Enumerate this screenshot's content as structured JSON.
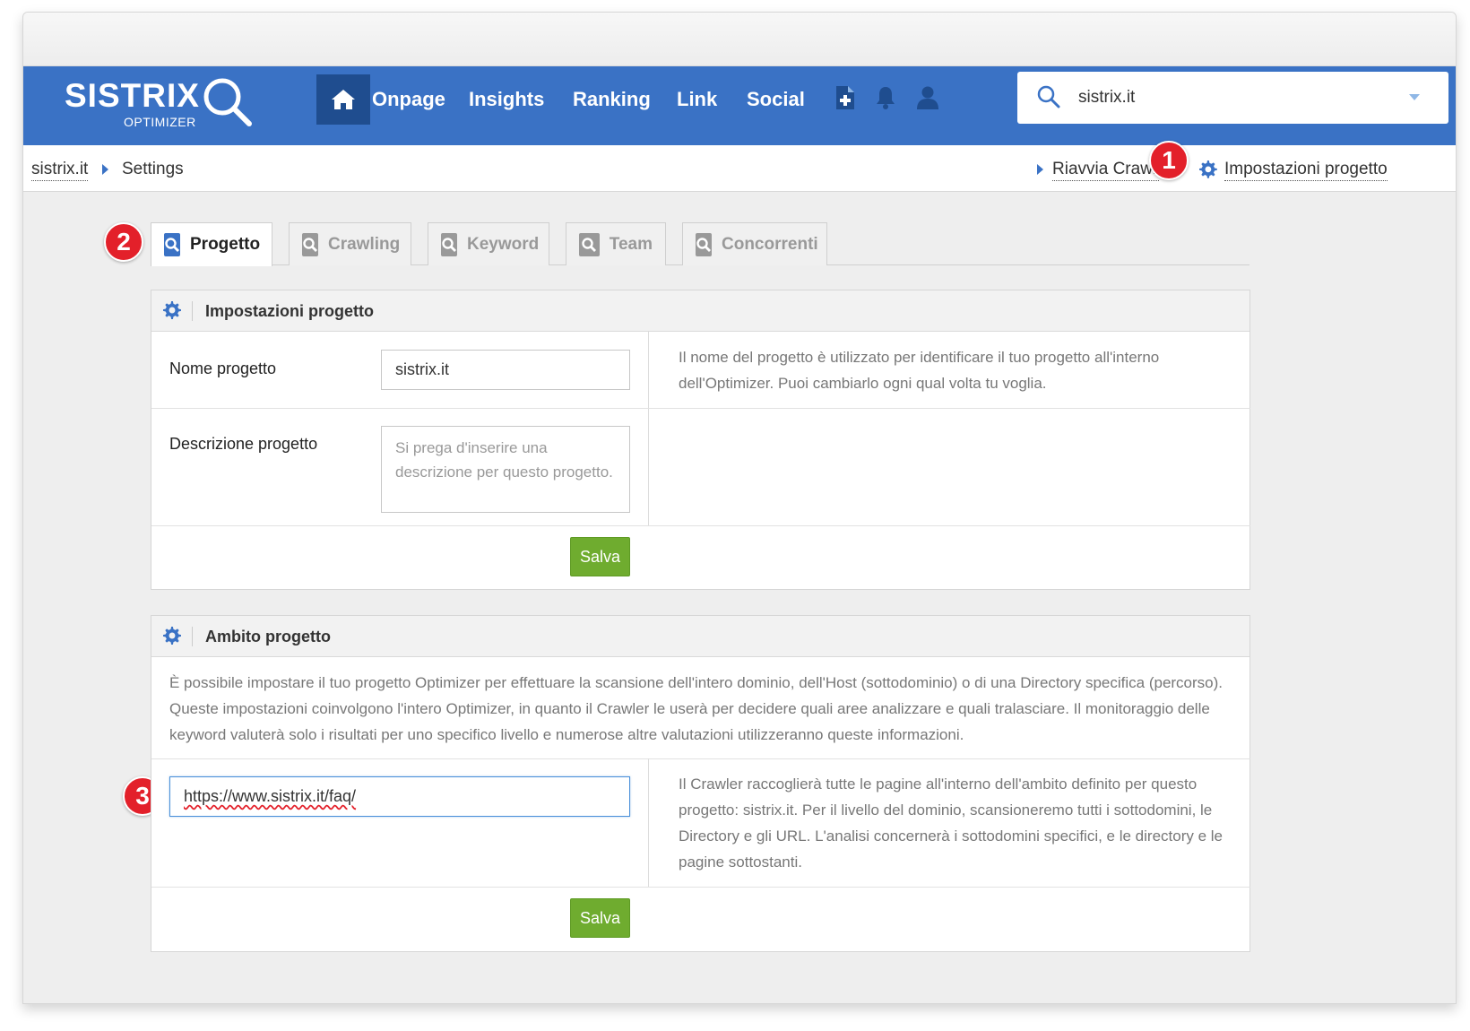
{
  "navbar": {
    "logo_text": "SISTRIX",
    "logo_sub": "OPTIMIZER",
    "items": [
      "Onpage",
      "Insights",
      "Ranking",
      "Link",
      "Social"
    ],
    "search_value": "sistrix.it"
  },
  "breadcrumb": {
    "project": "sistrix.it",
    "current": "Settings",
    "restart_crawler": "Riavvia Crawler",
    "project_settings": "Impostazioni progetto"
  },
  "badges": [
    "1",
    "2",
    "3"
  ],
  "tabs": [
    "Progetto",
    "Crawling",
    "Keyword",
    "Team",
    "Concorrenti"
  ],
  "panel1": {
    "title": "Impostazioni progetto",
    "name_label": "Nome progetto",
    "name_value": "sistrix.it",
    "name_help": "Il nome del progetto è utilizzato per identificare il tuo progetto all'interno dell'Optimizer. Puoi cambiarlo ogni qual volta tu voglia.",
    "desc_label": "Descrizione progetto",
    "desc_placeholder": "Si prega d'inserire una descrizione per questo progetto.",
    "save": "Salva"
  },
  "panel2": {
    "title": "Ambito progetto",
    "intro": "È possibile impostare il tuo progetto Optimizer per effettuare la scansione dell'intero dominio, dell'Host (sottodominio) o di una Directory specifica (percorso). Queste impostazioni coinvolgono l'intero Optimizer, in quanto il Crawler le userà per decidere quali aree analizzare e quali tralasciare. Il monitoraggio delle keyword valuterà solo i risultati per uno specifico livello e numerose altre valutazioni utilizzeranno queste informazioni.",
    "url_value": "https://www.sistrix.it/faq/",
    "help": "Il Crawler raccoglierà tutte le pagine all'interno dell'ambito definito per questo progetto: sistrix.it. Per il livello del dominio, scansioneremo tutti i sottodomini, le Directory e gli URL. L'analisi concernerà i sottodomini specifici, e le directory e le pagine sottostanti.",
    "save": "Salva"
  },
  "colors": {
    "brand_blue": "#3a72c5",
    "home_dark": "#1f4d8f",
    "save_green": "#6fac2f",
    "badge_red": "#e3202a"
  }
}
